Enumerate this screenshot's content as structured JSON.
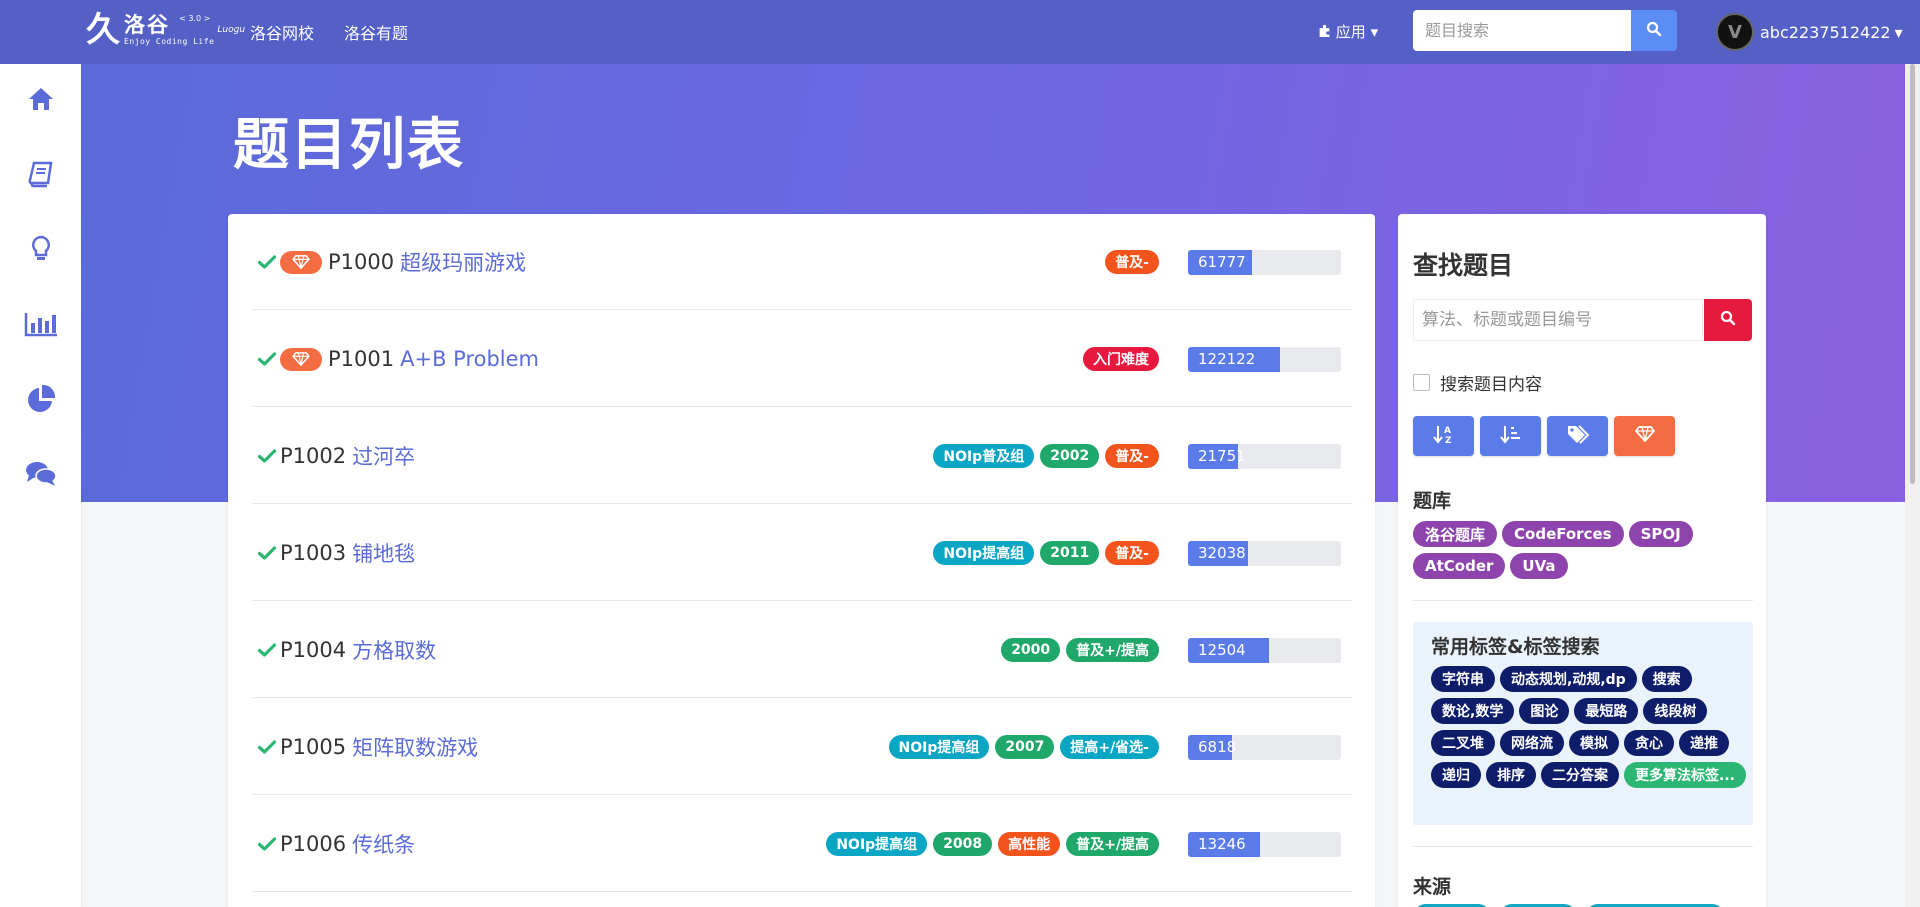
{
  "brand": {
    "mark": "久",
    "name": "洛谷",
    "version": "< 3.0 >",
    "pinyin": "Luogu",
    "slogan": "Enjoy Coding Life"
  },
  "nav": {
    "links": [
      "洛谷网校",
      "洛谷有题"
    ],
    "apps_label": "应用"
  },
  "search": {
    "placeholder": "题目搜索"
  },
  "user": {
    "name": "abc2237512422",
    "avatar_letter": "V"
  },
  "sidebar": {
    "items": [
      "home-icon",
      "book-icon",
      "lightbulb-icon",
      "bar-chart-icon",
      "pie-chart-icon",
      "comments-icon"
    ]
  },
  "page": {
    "title": "题目列表"
  },
  "problems": [
    {
      "id": "P1000",
      "title": "超级玛丽游戏",
      "gem": true,
      "tags": [
        {
          "text": "普及-",
          "color": "#f3541c"
        }
      ],
      "passed": "61777",
      "pass_ratio": 0.42
    },
    {
      "id": "P1001",
      "title": "A+B Problem",
      "gem": true,
      "tags": [
        {
          "text": "入门难度",
          "color": "#e7193f"
        }
      ],
      "passed": "122122",
      "pass_ratio": 0.6
    },
    {
      "id": "P1002",
      "title": "过河卒",
      "gem": false,
      "tags": [
        {
          "text": "NOIp普及组",
          "color": "#0aa6c4"
        },
        {
          "text": "2002",
          "color": "#20a86b"
        },
        {
          "text": "普及-",
          "color": "#f3541c"
        }
      ],
      "passed": "21751",
      "pass_ratio": 0.33
    },
    {
      "id": "P1003",
      "title": "铺地毯",
      "gem": false,
      "tags": [
        {
          "text": "NOIp提高组",
          "color": "#0aa6c4"
        },
        {
          "text": "2011",
          "color": "#20a86b"
        },
        {
          "text": "普及-",
          "color": "#f3541c"
        }
      ],
      "passed": "32038",
      "pass_ratio": 0.39
    },
    {
      "id": "P1004",
      "title": "方格取数",
      "gem": false,
      "tags": [
        {
          "text": "2000",
          "color": "#20a86b"
        },
        {
          "text": "普及+/提高",
          "color": "#20a86b"
        }
      ],
      "passed": "12504",
      "pass_ratio": 0.53
    },
    {
      "id": "P1005",
      "title": "矩阵取数游戏",
      "gem": false,
      "tags": [
        {
          "text": "NOIp提高组",
          "color": "#0aa6c4"
        },
        {
          "text": "2007",
          "color": "#20a86b"
        },
        {
          "text": "提高+/省选-",
          "color": "#0aa6c4"
        }
      ],
      "passed": "6818",
      "pass_ratio": 0.29
    },
    {
      "id": "P1006",
      "title": "传纸条",
      "gem": false,
      "tags": [
        {
          "text": "NOIp提高组",
          "color": "#0aa6c4"
        },
        {
          "text": "2008",
          "color": "#20a86b"
        },
        {
          "text": "高性能",
          "color": "#f3541c"
        },
        {
          "text": "普及+/提高",
          "color": "#20a86b"
        }
      ],
      "passed": "13246",
      "pass_ratio": 0.47
    }
  ],
  "finder": {
    "title": "查找题目",
    "input_placeholder": "算法、标题或题目编号",
    "search_content_label": "搜索题目内容",
    "library_title": "题库",
    "libraries": [
      "洛谷题库",
      "CodeForces",
      "SPOJ",
      "AtCoder",
      "UVa"
    ],
    "common_title": "常用标签&标签搜索",
    "common_tags": [
      "字符串",
      "动态规划,动规,dp",
      "搜索",
      "数论,数学",
      "图论",
      "最短路",
      "线段树",
      "二叉堆",
      "网络流",
      "模拟",
      "贪心",
      "递推",
      "递归",
      "排序",
      "二分答案"
    ],
    "more_tags": "更多算法标签...",
    "source_title": "来源"
  }
}
